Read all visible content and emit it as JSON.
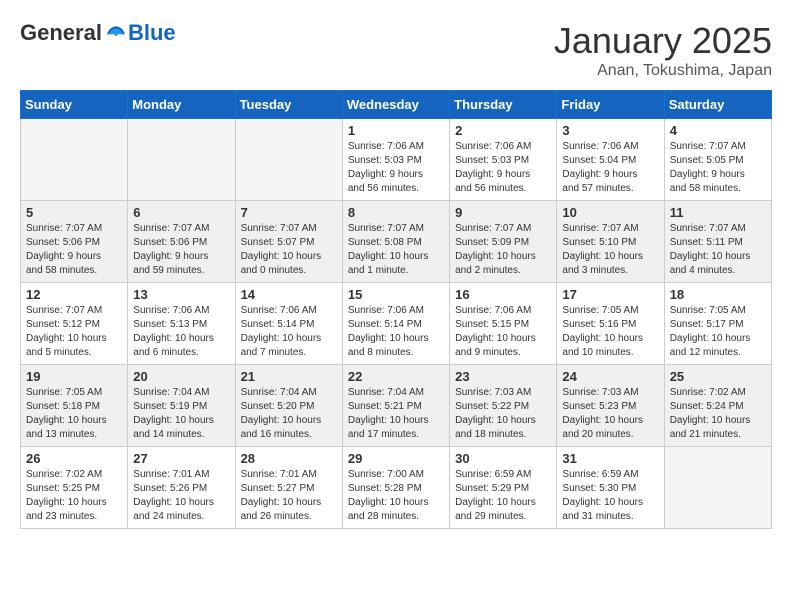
{
  "logo": {
    "general": "General",
    "blue": "Blue"
  },
  "header": {
    "month": "January 2025",
    "location": "Anan, Tokushima, Japan"
  },
  "weekdays": [
    "Sunday",
    "Monday",
    "Tuesday",
    "Wednesday",
    "Thursday",
    "Friday",
    "Saturday"
  ],
  "weeks": [
    [
      {
        "day": "",
        "info": ""
      },
      {
        "day": "",
        "info": ""
      },
      {
        "day": "",
        "info": ""
      },
      {
        "day": "1",
        "info": "Sunrise: 7:06 AM\nSunset: 5:03 PM\nDaylight: 9 hours\nand 56 minutes."
      },
      {
        "day": "2",
        "info": "Sunrise: 7:06 AM\nSunset: 5:03 PM\nDaylight: 9 hours\nand 56 minutes."
      },
      {
        "day": "3",
        "info": "Sunrise: 7:06 AM\nSunset: 5:04 PM\nDaylight: 9 hours\nand 57 minutes."
      },
      {
        "day": "4",
        "info": "Sunrise: 7:07 AM\nSunset: 5:05 PM\nDaylight: 9 hours\nand 58 minutes."
      }
    ],
    [
      {
        "day": "5",
        "info": "Sunrise: 7:07 AM\nSunset: 5:06 PM\nDaylight: 9 hours\nand 58 minutes."
      },
      {
        "day": "6",
        "info": "Sunrise: 7:07 AM\nSunset: 5:06 PM\nDaylight: 9 hours\nand 59 minutes."
      },
      {
        "day": "7",
        "info": "Sunrise: 7:07 AM\nSunset: 5:07 PM\nDaylight: 10 hours\nand 0 minutes."
      },
      {
        "day": "8",
        "info": "Sunrise: 7:07 AM\nSunset: 5:08 PM\nDaylight: 10 hours\nand 1 minute."
      },
      {
        "day": "9",
        "info": "Sunrise: 7:07 AM\nSunset: 5:09 PM\nDaylight: 10 hours\nand 2 minutes."
      },
      {
        "day": "10",
        "info": "Sunrise: 7:07 AM\nSunset: 5:10 PM\nDaylight: 10 hours\nand 3 minutes."
      },
      {
        "day": "11",
        "info": "Sunrise: 7:07 AM\nSunset: 5:11 PM\nDaylight: 10 hours\nand 4 minutes."
      }
    ],
    [
      {
        "day": "12",
        "info": "Sunrise: 7:07 AM\nSunset: 5:12 PM\nDaylight: 10 hours\nand 5 minutes."
      },
      {
        "day": "13",
        "info": "Sunrise: 7:06 AM\nSunset: 5:13 PM\nDaylight: 10 hours\nand 6 minutes."
      },
      {
        "day": "14",
        "info": "Sunrise: 7:06 AM\nSunset: 5:14 PM\nDaylight: 10 hours\nand 7 minutes."
      },
      {
        "day": "15",
        "info": "Sunrise: 7:06 AM\nSunset: 5:14 PM\nDaylight: 10 hours\nand 8 minutes."
      },
      {
        "day": "16",
        "info": "Sunrise: 7:06 AM\nSunset: 5:15 PM\nDaylight: 10 hours\nand 9 minutes."
      },
      {
        "day": "17",
        "info": "Sunrise: 7:05 AM\nSunset: 5:16 PM\nDaylight: 10 hours\nand 10 minutes."
      },
      {
        "day": "18",
        "info": "Sunrise: 7:05 AM\nSunset: 5:17 PM\nDaylight: 10 hours\nand 12 minutes."
      }
    ],
    [
      {
        "day": "19",
        "info": "Sunrise: 7:05 AM\nSunset: 5:18 PM\nDaylight: 10 hours\nand 13 minutes."
      },
      {
        "day": "20",
        "info": "Sunrise: 7:04 AM\nSunset: 5:19 PM\nDaylight: 10 hours\nand 14 minutes."
      },
      {
        "day": "21",
        "info": "Sunrise: 7:04 AM\nSunset: 5:20 PM\nDaylight: 10 hours\nand 16 minutes."
      },
      {
        "day": "22",
        "info": "Sunrise: 7:04 AM\nSunset: 5:21 PM\nDaylight: 10 hours\nand 17 minutes."
      },
      {
        "day": "23",
        "info": "Sunrise: 7:03 AM\nSunset: 5:22 PM\nDaylight: 10 hours\nand 18 minutes."
      },
      {
        "day": "24",
        "info": "Sunrise: 7:03 AM\nSunset: 5:23 PM\nDaylight: 10 hours\nand 20 minutes."
      },
      {
        "day": "25",
        "info": "Sunrise: 7:02 AM\nSunset: 5:24 PM\nDaylight: 10 hours\nand 21 minutes."
      }
    ],
    [
      {
        "day": "26",
        "info": "Sunrise: 7:02 AM\nSunset: 5:25 PM\nDaylight: 10 hours\nand 23 minutes."
      },
      {
        "day": "27",
        "info": "Sunrise: 7:01 AM\nSunset: 5:26 PM\nDaylight: 10 hours\nand 24 minutes."
      },
      {
        "day": "28",
        "info": "Sunrise: 7:01 AM\nSunset: 5:27 PM\nDaylight: 10 hours\nand 26 minutes."
      },
      {
        "day": "29",
        "info": "Sunrise: 7:00 AM\nSunset: 5:28 PM\nDaylight: 10 hours\nand 28 minutes."
      },
      {
        "day": "30",
        "info": "Sunrise: 6:59 AM\nSunset: 5:29 PM\nDaylight: 10 hours\nand 29 minutes."
      },
      {
        "day": "31",
        "info": "Sunrise: 6:59 AM\nSunset: 5:30 PM\nDaylight: 10 hours\nand 31 minutes."
      },
      {
        "day": "",
        "info": ""
      }
    ]
  ]
}
